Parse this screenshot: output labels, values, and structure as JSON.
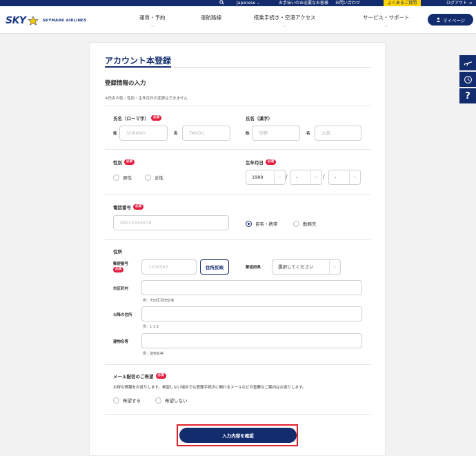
{
  "utility_bar": {
    "search_icon": "search-icon",
    "language": "Japanese ⌄",
    "passenger_help": "お手伝いのお必要なお客様",
    "contact": "お問い合わせ",
    "faq": "よくあるご質問",
    "logout": "ログアウト",
    "accent_color": "#ffd400"
  },
  "header": {
    "logo_text": "SKY",
    "logo_name": "SKYMARK AIRLINES",
    "nav": [
      "運賃・予約",
      "運航路線",
      "搭乗手続き・空港アクセス",
      "サービス・サポート"
    ],
    "mypage_label": "マイページ",
    "brand_color": "#132c6e"
  },
  "form": {
    "title": "アカウント本登録",
    "section_title": "登録情報の入力",
    "note": "※氏名の姓・性別・生年月日の変更はできません",
    "required_badge": "必須",
    "name_roman": {
      "label": "氏名（ローマ字）",
      "last_label": "姓",
      "last_placeholder": "SORANO",
      "first_label": "名",
      "first_placeholder": "TAROU"
    },
    "name_kanji": {
      "label": "氏名（漢字）",
      "last_label": "姓",
      "last_placeholder": "空野",
      "first_label": "名",
      "first_placeholder": "太郎"
    },
    "gender": {
      "label": "性別",
      "options": [
        "男性",
        "女性"
      ]
    },
    "birthdate": {
      "label": "生年月日",
      "year": "1989",
      "month": "-",
      "day": "-",
      "separator": "/"
    },
    "phone": {
      "label": "電話番号",
      "placeholder": "09012345678",
      "options": [
        "自宅・携帯",
        "勤務先"
      ],
      "selected": "自宅・携帯"
    },
    "address": {
      "label": "住所",
      "postal_label": "郵便番号",
      "postal_placeholder": "1234567",
      "reflect_button": "住所反映",
      "prefecture_label": "都道府県",
      "prefecture_value": "選択してください",
      "city_label": "市区町村",
      "city_example": "例：大田区羽田空港",
      "street_label": "以降の住所",
      "street_example": "例：1-1-1",
      "building_label": "建物名等",
      "building_example": "例：建物名等"
    },
    "mail": {
      "label": "メール配信のご希望",
      "description": "お得な情報をお送りします。希望しない場合でも登録手続きに関わるメールなどの重要なご案内はお送りします。",
      "options": [
        "希望する",
        "希望しない"
      ]
    },
    "confirm_button": "入力内容を確認",
    "highlight_color": "#e0202a"
  },
  "side_buttons": [
    "plane-icon",
    "clock-icon",
    "help-icon"
  ],
  "side_help_glyph": "?"
}
